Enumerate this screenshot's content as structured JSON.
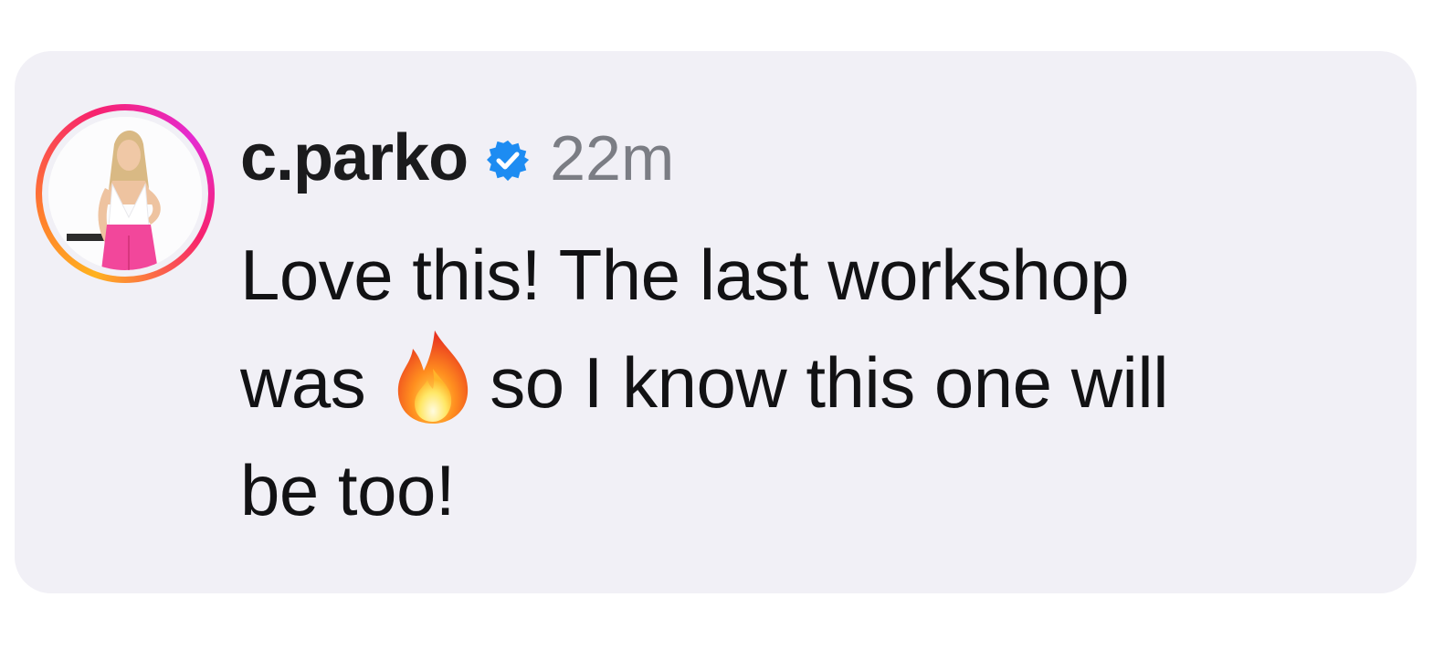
{
  "comment": {
    "username": "c.parko",
    "verified_icon": "verified-badge-icon",
    "timestamp": "22m",
    "text_part1": "Love this! The last workshop",
    "text_part2_before_emoji": "was",
    "emoji_icon": "fire-emoji-icon",
    "text_part2_after_emoji": "so I know this one will",
    "text_part3": "be too!"
  },
  "colors": {
    "card_background": "#f1f0f6",
    "verified_blue": "#1d8cf2",
    "username_text": "#1b1b1d",
    "timestamp_text": "#7b7d84",
    "body_text": "#121214"
  }
}
